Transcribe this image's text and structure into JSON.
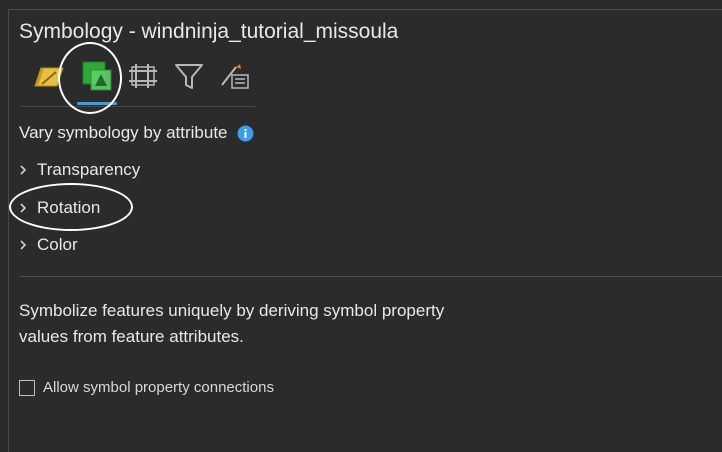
{
  "window": {
    "title": "Symbology - windninja_tutorial_missoula"
  },
  "tabs": [
    {
      "icon": "primary-symbology-icon",
      "active": false
    },
    {
      "icon": "vary-by-attribute-icon",
      "active": true
    },
    {
      "icon": "symbol-layers-icon",
      "active": false
    },
    {
      "icon": "filter-icon",
      "active": false
    },
    {
      "icon": "symbol-properties-icon",
      "active": false
    }
  ],
  "section": {
    "heading": "Vary symbology by attribute",
    "info_icon": "info-icon"
  },
  "expanders": [
    {
      "label": "Transparency"
    },
    {
      "label": "Rotation"
    },
    {
      "label": "Color"
    }
  ],
  "description": "Symbolize features uniquely by deriving symbol property values from feature attributes.",
  "options": {
    "allow_connections_label": "Allow symbol property connections",
    "allow_connections_checked": false
  },
  "colors": {
    "background": "#2b2b2b",
    "accent": "#3a9ee8",
    "text": "#e8e8e8",
    "annotation": "#ffffff"
  }
}
